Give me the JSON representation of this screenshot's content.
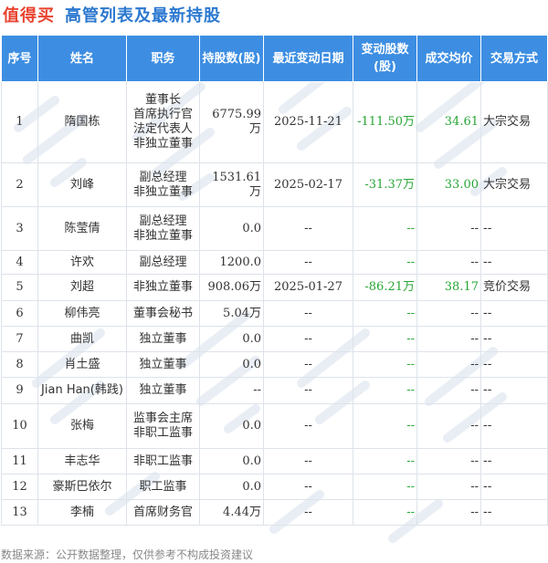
{
  "header": {
    "brand": "值得买",
    "title": "高管列表及最新持股"
  },
  "table": {
    "columns": [
      "序号",
      "姓名",
      "职务",
      "持股数(股)",
      "最近变动日期",
      "变动股数(股)",
      "成交均价",
      "交易方式"
    ],
    "rows": [
      {
        "no": "1",
        "name": "隋国栋",
        "roles": [
          "董事长",
          "首席执行官",
          "法定代表人",
          "非独立董事"
        ],
        "shares": "6775.99万",
        "date": "2025-11-21",
        "change": "-111.50万",
        "price": "34.61",
        "method": "大宗交易"
      },
      {
        "no": "2",
        "name": "刘峰",
        "roles": [
          "副总经理",
          "非独立董事"
        ],
        "shares": "1531.61万",
        "date": "2025-02-17",
        "change": "-31.37万",
        "price": "33.00",
        "method": "大宗交易"
      },
      {
        "no": "3",
        "name": "陈莹倩",
        "roles": [
          "副总经理",
          "非独立董事"
        ],
        "shares": "0.0",
        "date": "--",
        "change": "--",
        "price": "--",
        "method": "--"
      },
      {
        "no": "4",
        "name": "许欢",
        "roles": [
          "副总经理"
        ],
        "shares": "1200.0",
        "date": "--",
        "change": "--",
        "price": "--",
        "method": "--"
      },
      {
        "no": "5",
        "name": "刘超",
        "roles": [
          "非独立董事"
        ],
        "shares": "908.06万",
        "date": "2025-01-27",
        "change": "-86.21万",
        "price": "38.17",
        "method": "竞价交易"
      },
      {
        "no": "6",
        "name": "柳伟亮",
        "roles": [
          "董事会秘书"
        ],
        "shares": "5.04万",
        "date": "--",
        "change": "--",
        "price": "--",
        "method": "--"
      },
      {
        "no": "7",
        "name": "曲凯",
        "roles": [
          "独立董事"
        ],
        "shares": "0.0",
        "date": "--",
        "change": "--",
        "price": "--",
        "method": "--"
      },
      {
        "no": "8",
        "name": "肖土盛",
        "roles": [
          "独立董事"
        ],
        "shares": "0.0",
        "date": "--",
        "change": "--",
        "price": "--",
        "method": "--"
      },
      {
        "no": "9",
        "name": "Jian Han(韩践)",
        "roles": [
          "独立董事"
        ],
        "shares": "--",
        "date": "--",
        "change": "--",
        "price": "--",
        "method": "--"
      },
      {
        "no": "10",
        "name": "张梅",
        "roles": [
          "监事会主席",
          "非职工监事"
        ],
        "shares": "0.0",
        "date": "--",
        "change": "--",
        "price": "--",
        "method": "--"
      },
      {
        "no": "11",
        "name": "丰志华",
        "roles": [
          "非职工监事"
        ],
        "shares": "0.0",
        "date": "--",
        "change": "--",
        "price": "--",
        "method": "--"
      },
      {
        "no": "12",
        "name": "豪斯巴依尔",
        "roles": [
          "职工监事"
        ],
        "shares": "0.0",
        "date": "--",
        "change": "--",
        "price": "--",
        "method": "--"
      },
      {
        "no": "13",
        "name": "李楠",
        "roles": [
          "首席财务官"
        ],
        "shares": "4.44万",
        "date": "--",
        "change": "--",
        "price": "--",
        "method": "--"
      }
    ]
  },
  "footer": {
    "source": "数据来源：公开数据整理，仅供参考不构成投资建议"
  },
  "colors": {
    "brand": "#e8422f",
    "title": "#2b78d0",
    "header_bg": "#3d8ee2",
    "change": "#27a635"
  }
}
